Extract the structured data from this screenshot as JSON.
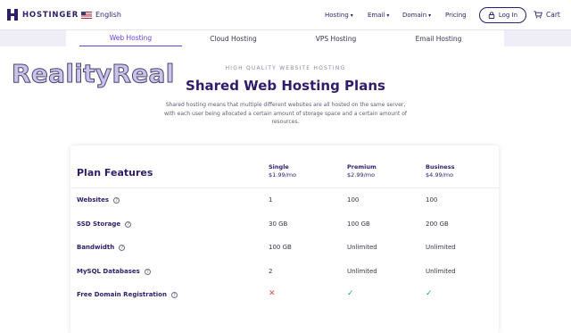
{
  "nav": {
    "brand": "HOSTINGER",
    "language": "English",
    "menu": [
      "Hosting",
      "Email",
      "Domain",
      "Pricing"
    ],
    "login": "Log In",
    "cart": "Cart"
  },
  "tabs": [
    "Web Hosting",
    "Cloud Hosting",
    "VPS Hosting",
    "Email Hosting"
  ],
  "watermark": "RealityReal",
  "hero": {
    "eyebrow": "HIGH QUALITY WEBSITE HOSTING",
    "title": "Shared Web Hosting Plans",
    "description": "Shared hosting means that multiple different websites are all hosted on the same server, with each user being allocated a certain amount of storage space and a certain amount of resources."
  },
  "table": {
    "heading": "Plan Features",
    "plans": [
      {
        "name": "Single",
        "price": "$1.99/mo"
      },
      {
        "name": "Premium",
        "price": "$2.99/mo"
      },
      {
        "name": "Business",
        "price": "$4.99/mo"
      }
    ],
    "rows": [
      {
        "feature": "Websites",
        "values": [
          "1",
          "100",
          "100"
        ]
      },
      {
        "feature": "SSD Storage",
        "values": [
          "30 GB",
          "100 GB",
          "200 GB"
        ]
      },
      {
        "feature": "Bandwidth",
        "values": [
          "100 GB",
          "Unlimited",
          "Unlimited"
        ]
      },
      {
        "feature": "MySQL Databases",
        "values": [
          "2",
          "Unlimited",
          "Unlimited"
        ]
      },
      {
        "feature": "Free Domain Registration",
        "values": [
          "✕",
          "✓",
          "✓"
        ]
      }
    ]
  },
  "colors": {
    "brand": "#2f1c6a",
    "accent": "#673de6",
    "check": "#00b090",
    "cross": "#e04b4b"
  }
}
